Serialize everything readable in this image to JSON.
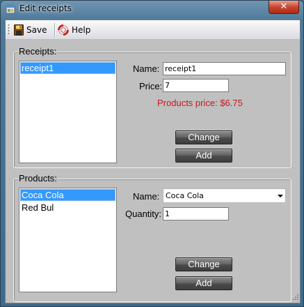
{
  "window": {
    "title": "Edit receipts",
    "close_glyph": "✕"
  },
  "toolbar": {
    "save_label": "Save",
    "help_label": "Help"
  },
  "receipts": {
    "legend": "Receipts:",
    "items": [
      {
        "label": "receipt1",
        "selected": true
      }
    ],
    "name_label": "Name:",
    "name_value": "receipt1",
    "price_label": "Price:",
    "price_value": "7",
    "products_price_text": "Products price: $6.75",
    "change_label": "Change",
    "add_label": "Add"
  },
  "products": {
    "legend": "Products:",
    "items": [
      {
        "label": "Coca Cola",
        "selected": true
      },
      {
        "label": "Red Bul",
        "selected": false
      }
    ],
    "name_label": "Name:",
    "name_value": "Coca Cola",
    "quantity_label": "Quantity:",
    "quantity_value": "1",
    "change_label": "Change",
    "add_label": "Add"
  },
  "colors": {
    "selection": "#3399ff",
    "warning_text": "#c11a1a",
    "button_dark": "#4b4b4b",
    "client_bg": "#c0c0c0"
  },
  "icons": [
    "app-icon",
    "save-disk-icon",
    "help-lifebuoy-icon",
    "close-icon",
    "chevron-down-icon"
  ]
}
